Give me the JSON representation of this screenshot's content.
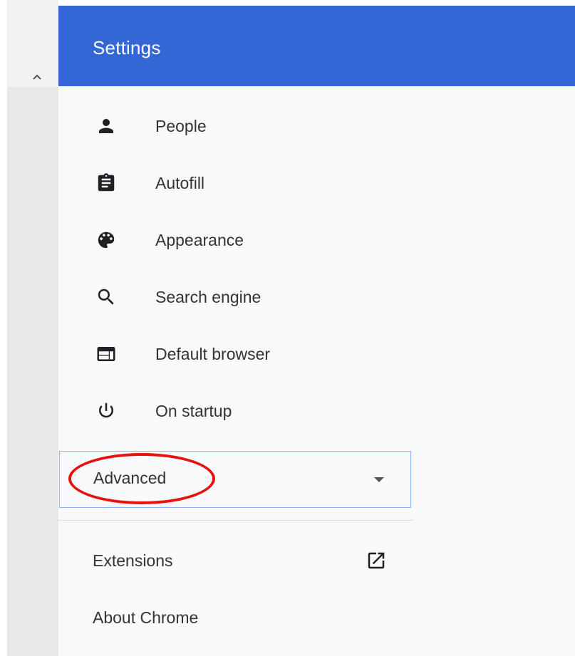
{
  "header": {
    "title": "Settings"
  },
  "nav": {
    "items": [
      {
        "label": "People",
        "icon": "person-icon"
      },
      {
        "label": "Autofill",
        "icon": "clipboard-icon"
      },
      {
        "label": "Appearance",
        "icon": "palette-icon"
      },
      {
        "label": "Search engine",
        "icon": "search-icon"
      },
      {
        "label": "Default browser",
        "icon": "browser-window-icon"
      },
      {
        "label": "On startup",
        "icon": "power-icon"
      }
    ],
    "advanced": {
      "label": "Advanced"
    },
    "links": [
      {
        "label": "Extensions",
        "icon": "open-in-new-icon"
      },
      {
        "label": "About Chrome"
      }
    ]
  },
  "colors": {
    "header": "#3367d6",
    "highlight": "#e8120c",
    "text": "#333333",
    "background": "#f8f9fa"
  }
}
